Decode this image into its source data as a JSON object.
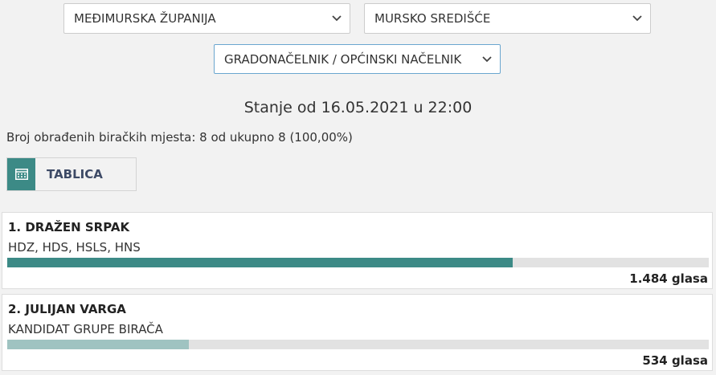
{
  "filters": {
    "county": "MEĐIMURSKA ŽUPANIJA",
    "town": "MURSKO SREDIŠĆE",
    "office": "GRADONAČELNIK / OPĆINSKI NAČELNIK"
  },
  "status": "Stanje od 16.05.2021 u 22:00",
  "polling_stations": "Broj obrađenih biračkih mjesta: 8 od ukupno 8 (100,00%)",
  "view_button": {
    "label": "TABLICA",
    "icon": "table-icon"
  },
  "colors": {
    "accent": "#3c8a86",
    "bar_first": "#3c8a86",
    "bar_second": "#9fc3c1",
    "bar_track": "#e2e2e2"
  },
  "candidates": [
    {
      "name": "1. DRAŽEN SRPAK",
      "party": "HDZ, HDS, HSLS, HNS",
      "votes": "1.484 glasa",
      "share_of_max": 1.0
    },
    {
      "name": "2. JULIJAN VARGA",
      "party": "KANDIDAT GRUPE BIRAČA",
      "votes": "534 glasa",
      "share_of_max": 0.36
    }
  ]
}
